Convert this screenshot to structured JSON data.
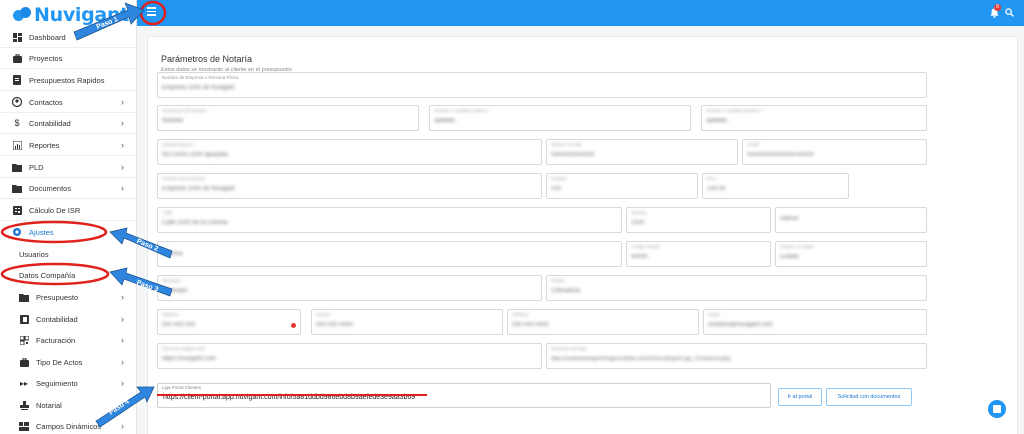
{
  "brand": {
    "name": "Nuvigant",
    "color": "#2196f3"
  },
  "sidebar": {
    "items": [
      {
        "label": "Dashboard",
        "icon": "dashboard-icon",
        "has_chevron": false
      },
      {
        "label": "Proyectos",
        "icon": "briefcase-icon",
        "has_chevron": false
      },
      {
        "label": "Presupuestos Rapidos",
        "icon": "document-icon",
        "has_chevron": false
      },
      {
        "label": "Contactos",
        "icon": "account-icon",
        "has_chevron": true
      },
      {
        "label": "Contabilidad",
        "icon": "dollar-icon",
        "has_chevron": true
      },
      {
        "label": "Reportes",
        "icon": "chart-icon",
        "has_chevron": true
      },
      {
        "label": "PLD",
        "icon": "folder-lock-icon",
        "has_chevron": true
      },
      {
        "label": "Documentos",
        "icon": "folder-icon",
        "has_chevron": true
      },
      {
        "label": "Cálculo De ISR",
        "icon": "calculator-icon",
        "has_chevron": false
      },
      {
        "label": "Ajustes",
        "icon": "gear-icon",
        "has_chevron": false,
        "active": true
      },
      {
        "label": "Usuarios",
        "icon": "",
        "has_chevron": false
      },
      {
        "label": "Datos Compañía",
        "icon": "",
        "has_chevron": false
      },
      {
        "label": "Presupuesto",
        "icon": "folder-icon",
        "has_chevron": true
      },
      {
        "label": "Contabilidad",
        "icon": "ledger-icon",
        "has_chevron": true
      },
      {
        "label": "Facturación",
        "icon": "qr-icon",
        "has_chevron": true
      },
      {
        "label": "Tipo De Actos",
        "icon": "briefcase-icon",
        "has_chevron": true
      },
      {
        "label": "Seguimiento",
        "icon": "fast-forward-icon",
        "has_chevron": true
      },
      {
        "label": "Notarial",
        "icon": "stamp-icon",
        "has_chevron": false
      },
      {
        "label": "Campos Dinámicos",
        "icon": "fields-icon",
        "has_chevron": true
      }
    ]
  },
  "topbar": {
    "notification_count": "8"
  },
  "panel": {
    "title": "Parámetros de Notaría",
    "subtitle": "Estos datos se mostrarán al cliente en el presupuesto",
    "fields": {
      "empresa": {
        "label": "Nombre de Empresa o Persona Física",
        "value": "Empresa 1000 de Nuvigant"
      },
      "nombre": {
        "label": "Nombre(s) del Notario",
        "value": "Nombre"
      },
      "ap_paterno": {
        "label": "Nombre o Apellido Paterno *",
        "value": "Apellido"
      },
      "ap_materno": {
        "label": "Nombre o Apellido Materno *",
        "value": "Apellido"
      },
      "notaria_num": {
        "label": "Notaria Número",
        "value": "NOTARIA 1000 apoyada"
      },
      "numero_ine": {
        "label": "Número de INE",
        "value": "0000000000000"
      },
      "curp": {
        "label": "CURP",
        "value": "AAAA000000HDFAAA00"
      },
      "nombre_fiscal": {
        "label": "Nombre de la Notaría",
        "value": "Empresa 1000 de Nuvigant"
      },
      "entidad": {
        "label": "Entidad",
        "value": "100"
      },
      "rfc": {
        "label": "RFC",
        "value": "100.00"
      },
      "calle": {
        "label": "Calle",
        "value": "Calle 1000 de la Colonia"
      },
      "numero_ext": {
        "label": "Número",
        "value": "1000"
      },
      "numero_int": {
        "label": "",
        "value": "Interior"
      },
      "colonia": {
        "label": "",
        "value": "Colonia"
      },
      "codigo_postal": {
        "label": "Código Postal",
        "value": "00000"
      },
      "estado": {
        "label": "Estado o Ciudad",
        "value": "Estado"
      },
      "municipio": {
        "label": "Municipio",
        "value": "Municipio"
      },
      "estado2": {
        "label": "Estado",
        "value": "Chihuahua"
      },
      "telefono": {
        "label": "Teléfono",
        "value": "000 000 000"
      },
      "celular": {
        "label": "Celular",
        "value": "000 000 0000"
      },
      "telefono2": {
        "label": "Teléfono",
        "value": "000 000 0000"
      },
      "email": {
        "label": "Email",
        "value": "contacto@nuvigant.com"
      },
      "web": {
        "label": "Dirección página web",
        "value": "https://nuvigant.com"
      },
      "logo_url": {
        "label": "Dirección del logo",
        "value": "https://notariamanager/imagenes/data.com/archivos/logos/Logo_Constancia.jpeg"
      }
    },
    "portal": {
      "label": "Liga Portal Clientes",
      "value": "https://client-portal.app.nuvigant.com/info/5a81ddbd986ebd8b9aefede3e9aa3b69",
      "go_button": "Ir al portal",
      "request_button": "Solicitud con documentos"
    }
  },
  "annotations": {
    "paso1": "Paso 1",
    "paso2": "Paso 2",
    "paso3": "Paso 3",
    "paso4": "Paso 4",
    "arrow_color": "#2e86de",
    "circle_color": "#e0201b"
  }
}
